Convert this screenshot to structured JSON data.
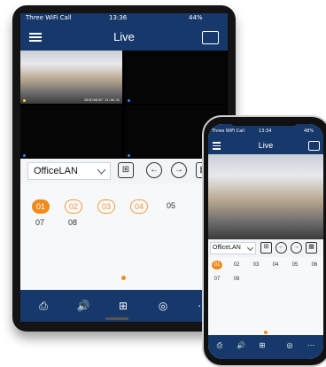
{
  "tablet": {
    "status": {
      "carrier": "Three WiFi Call",
      "time": "13:36",
      "battery": "44%"
    },
    "title": "Live",
    "camera_stamp": "2019/08/07 13:36:31",
    "toolbar": {
      "device": "OfficeLAN"
    },
    "channels": [
      "01",
      "02",
      "03",
      "04",
      "05",
      "07",
      "08"
    ],
    "bottom_icons": [
      "playback-icon",
      "speaker-icon",
      "layout-icon",
      "ptz-icon",
      "more-icon"
    ]
  },
  "phone": {
    "status": {
      "carrier": "Three WiFi Call",
      "time": "13:34",
      "battery": "48%"
    },
    "title": "Live",
    "toolbar": {
      "device": "OfficeLAN"
    },
    "channels": [
      "01",
      "02",
      "03",
      "04",
      "05",
      "06",
      "07",
      "08"
    ]
  },
  "colors": {
    "navy": "#16386a",
    "accent": "#f08a1c"
  }
}
